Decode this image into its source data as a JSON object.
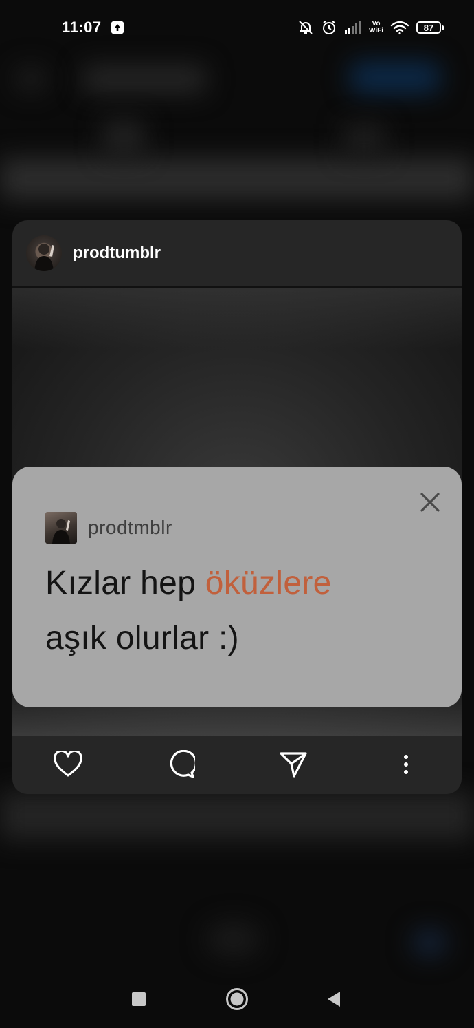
{
  "status_bar": {
    "time": "11:07",
    "volte_top": "Vo",
    "volte_bottom": "WiFi",
    "battery": "87"
  },
  "post": {
    "username": "prodtumblr",
    "media": {
      "card_username": "prodtmblr",
      "text_part1": "Kızlar hep ",
      "text_accent": "öküzlere",
      "text_part2": "aşık olurlar :)",
      "accent_color": "#c1603c"
    },
    "actions": [
      "heart-icon",
      "comment-icon",
      "send-icon",
      "more-icon"
    ]
  },
  "nav_bar": [
    "recents-button",
    "home-button",
    "back-button"
  ]
}
